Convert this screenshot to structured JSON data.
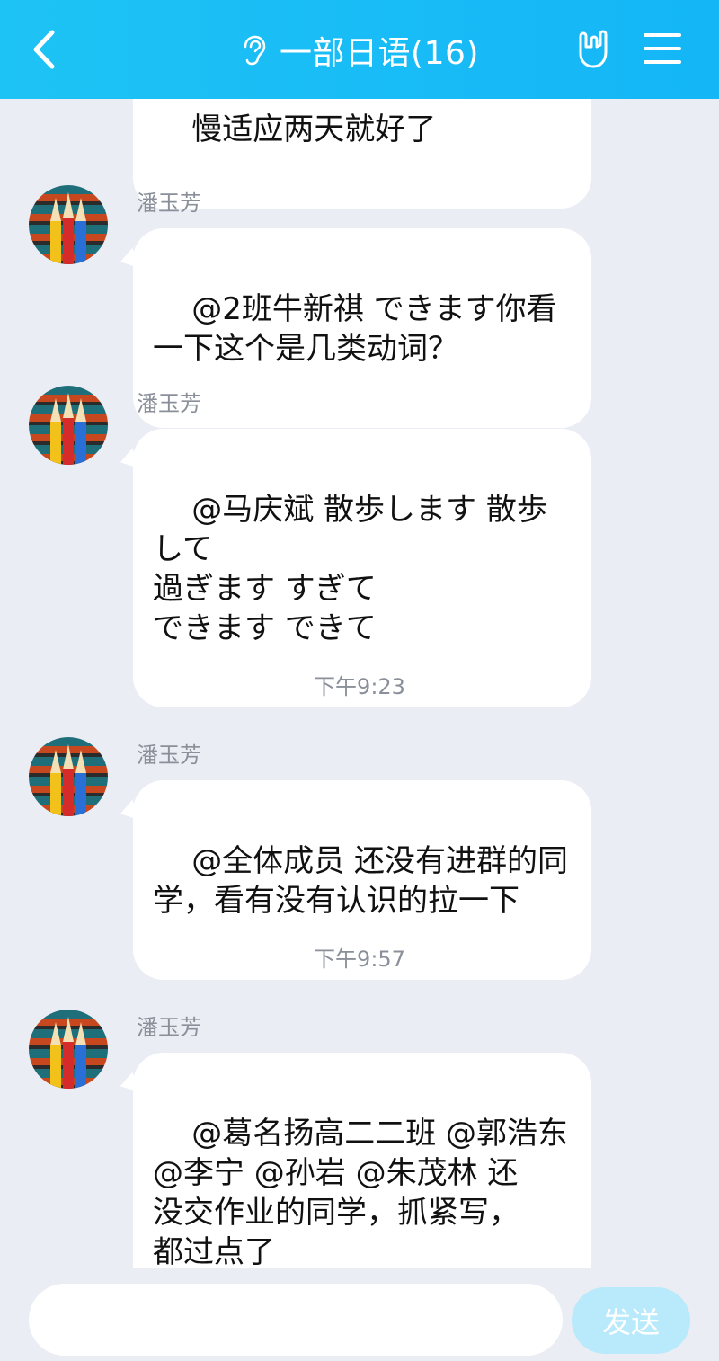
{
  "header": {
    "title": "一部日语(16)",
    "back_icon": "chevron-left-icon",
    "ear_icon": "ear-icon",
    "hand_icon": "rock-hand-icon",
    "menu_icon": "hamburger-menu-icon",
    "background_color": "#14b6f6"
  },
  "messages": [
    {
      "type": "partial",
      "text": "慢适应两天就好了"
    },
    {
      "type": "message",
      "sender": "潘玉芳",
      "text": "@2班牛新祺 できます你看\n一下这个是几类动词？"
    },
    {
      "type": "message",
      "sender": "潘玉芳",
      "text": "@马庆斌 散歩します 散歩\nして\n過ぎます すぎて\nできます できて"
    },
    {
      "type": "time",
      "text": "下午9:23"
    },
    {
      "type": "message",
      "sender": "潘玉芳",
      "text": "@全体成员 还没有进群的同\n学，看有没有认识的拉一下"
    },
    {
      "type": "time",
      "text": "下午9:57"
    },
    {
      "type": "message",
      "sender": "潘玉芳",
      "text": "@葛名扬高二二班 @郭浩东\n@李宁 @孙岩 @朱茂林 还\n没交作业的同学，抓紧写，\n都过点了"
    }
  ],
  "composer": {
    "input_value": "",
    "input_placeholder": "",
    "send_label": "发送",
    "send_color": "#b9eafb"
  }
}
